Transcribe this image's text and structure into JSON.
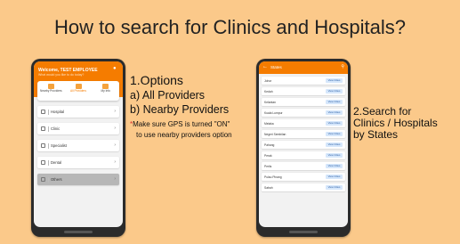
{
  "slide": {
    "title": "How to search for Clinics and Hospitals?"
  },
  "left_phone": {
    "welcome": "Welcome, TEST EMPLOYEE",
    "subtitle": "What would you like to do today?",
    "bell_icon": "bell-icon",
    "tabs": [
      {
        "label": "Nearby Providers",
        "icon": "location-icon",
        "active": false
      },
      {
        "label": "All Providers",
        "icon": "hospital-icon",
        "active": true
      },
      {
        "label": "My Info",
        "icon": "person-icon",
        "active": false
      }
    ],
    "items": [
      {
        "label": "Hospital",
        "icon": "hospital-icon"
      },
      {
        "label": "Clinic",
        "icon": "clinic-icon"
      },
      {
        "label": "Specialist",
        "icon": "specialist-icon"
      },
      {
        "label": "Dental",
        "icon": "dental-icon"
      },
      {
        "label": "Others",
        "icon": "others-icon"
      }
    ]
  },
  "right_phone": {
    "title": "States",
    "button_label": "View Cities",
    "states": [
      "Johor",
      "Kedah",
      "Kelantan",
      "Kuala Lumpur",
      "Melaka",
      "Negeri Sembilan",
      "Pahang",
      "Perak",
      "Perlis",
      "Pulau Pinang",
      "Sabah"
    ]
  },
  "options_text": {
    "title": "1.Options",
    "a": "a) All Providers",
    "b": "b) Nearby Providers",
    "note_star": "*",
    "note_1": "Make sure GPS is turned \"ON\"",
    "note_2": "to use nearby providers option"
  },
  "search_text": {
    "line1": "2.Search for",
    "line2": "Clinics / Hospitals",
    "line3": "by States"
  },
  "colors": {
    "background": "#fbc98a",
    "app_orange": "#f57c00"
  }
}
